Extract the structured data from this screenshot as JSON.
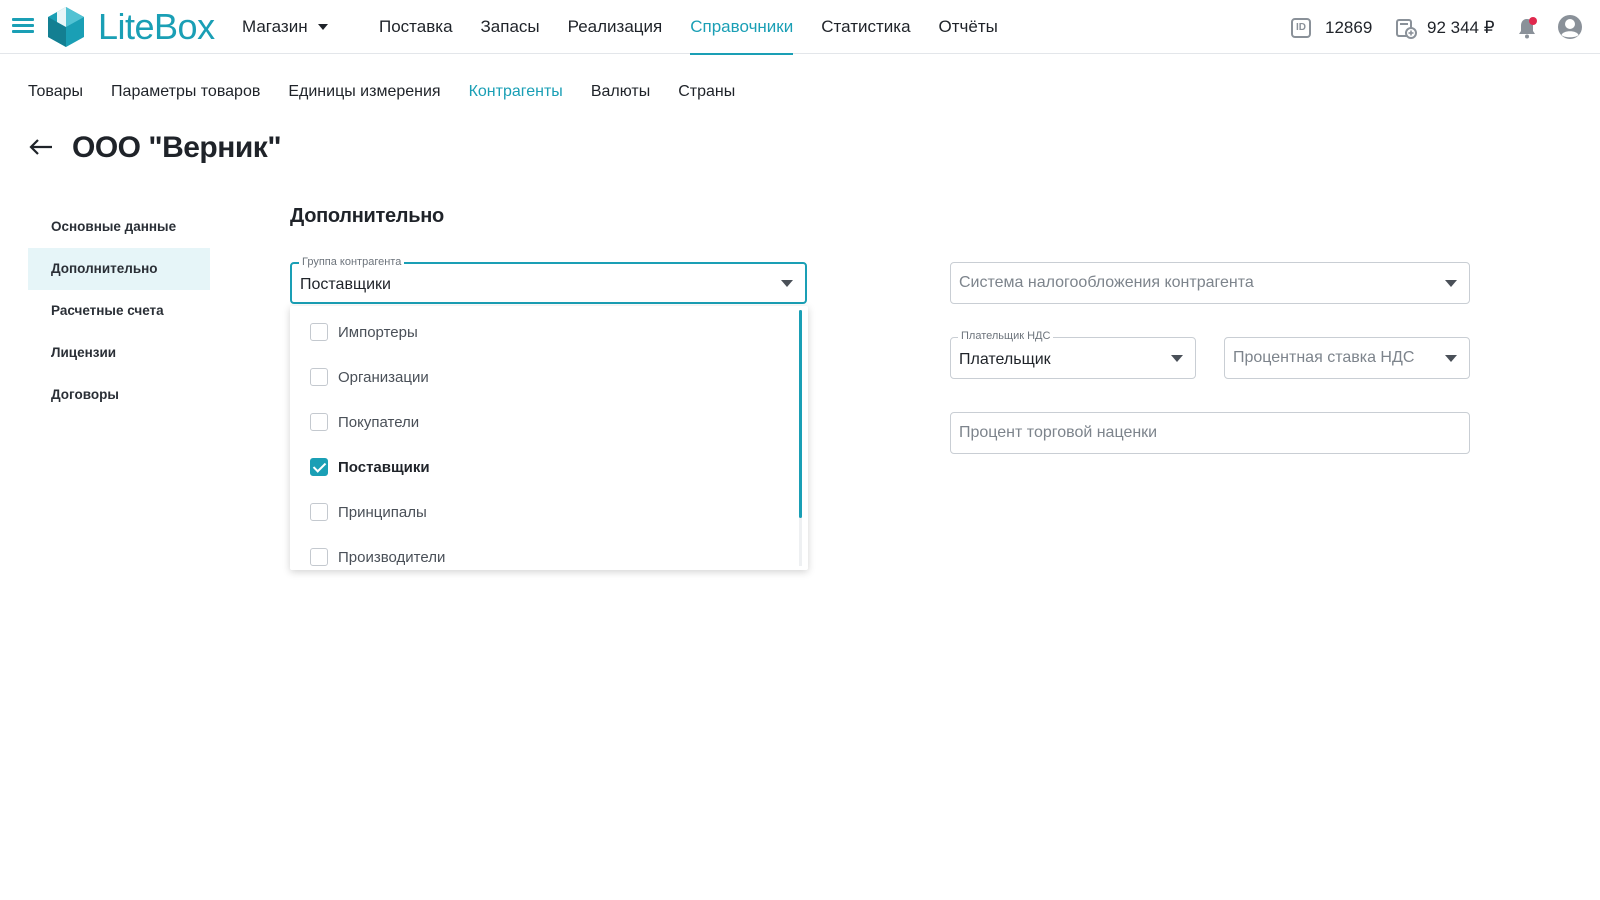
{
  "app": {
    "logo_text": "LiteBox",
    "store_selector": "Магазин",
    "accent_color": "#1a9fb5"
  },
  "main_nav": [
    {
      "label": "Поставка"
    },
    {
      "label": "Запасы"
    },
    {
      "label": "Реализация"
    },
    {
      "label": "Справочники",
      "active": true
    },
    {
      "label": "Статистика"
    },
    {
      "label": "Отчёты"
    }
  ],
  "header_right": {
    "id_value": "12869",
    "balance": "92 344 ₽",
    "icons": [
      "id-icon",
      "wallet-icon",
      "bell-icon",
      "user-icon"
    ]
  },
  "sub_nav": [
    {
      "label": "Товары"
    },
    {
      "label": "Параметры товаров"
    },
    {
      "label": "Единицы измерения"
    },
    {
      "label": "Контрагенты",
      "active": true
    },
    {
      "label": "Валюты"
    },
    {
      "label": "Страны"
    }
  ],
  "page": {
    "title": "ООО \"Верник\""
  },
  "side_menu": [
    {
      "label": "Основные данные"
    },
    {
      "label": "Дополнительно",
      "active": true
    },
    {
      "label": "Расчетные счета"
    },
    {
      "label": "Лицензии"
    },
    {
      "label": "Договоры"
    }
  ],
  "section": {
    "title": "Дополнительно",
    "group_field": {
      "label": "Группа контрагента",
      "value": "Поставщики"
    },
    "tax_system_field": {
      "placeholder": "Система налогообложения контрагента"
    },
    "vat_payer_field": {
      "label": "Плательщик НДС",
      "value": "Плательщик"
    },
    "vat_rate_field": {
      "placeholder": "Процентная ставка НДС"
    },
    "markup_field": {
      "placeholder": "Процент торговой наценки"
    }
  },
  "group_dropdown": {
    "options": [
      {
        "label": "Импортеры",
        "checked": false
      },
      {
        "label": "Организации",
        "checked": false
      },
      {
        "label": "Покупатели",
        "checked": false
      },
      {
        "label": "Поставщики",
        "checked": true
      },
      {
        "label": "Принципалы",
        "checked": false
      },
      {
        "label": "Производители",
        "checked": false
      }
    ]
  }
}
